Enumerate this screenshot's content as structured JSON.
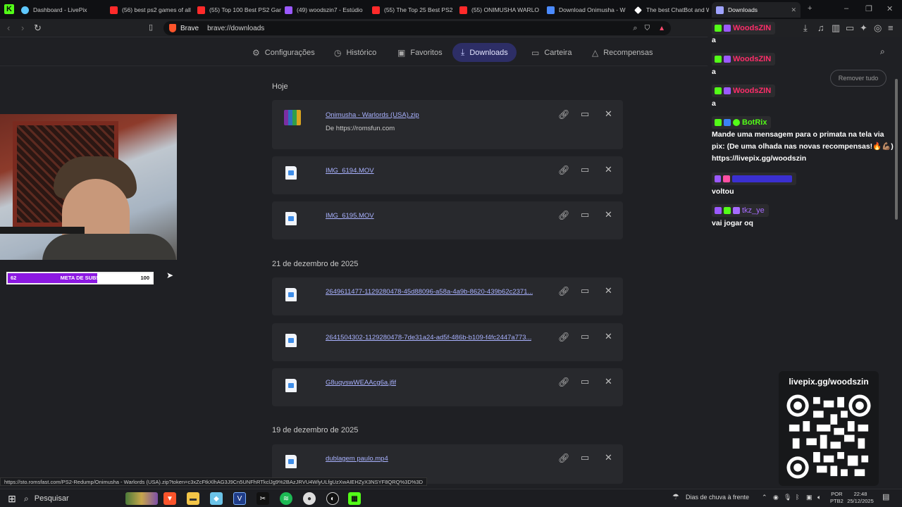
{
  "tabs": [
    {
      "title": "Dashboard - LivePix",
      "color": "#5ec8ff"
    },
    {
      "title": "(56) best ps2 games of all",
      "color": "#ff2a2a"
    },
    {
      "title": "(55) Top 100 Best PS2 Gar",
      "color": "#ff2a2a"
    },
    {
      "title": "(49) woodszin7 - Estúdio",
      "color": "#9b59ff"
    },
    {
      "title": "(55) The Top 25 Best PS2",
      "color": "#ff2a2a"
    },
    {
      "title": "(55) ONIMUSHA WARLO",
      "color": "#ff2a2a"
    },
    {
      "title": "Download Onimusha - W",
      "color": "#4b8bff"
    },
    {
      "title": "The best ChatBot and W",
      "color": "#ffffff"
    },
    {
      "title": "Downloads",
      "color": "#9fa3ff"
    }
  ],
  "toolbar": {
    "browser_name": "Brave",
    "url": "brave://downloads"
  },
  "nav": {
    "settings": "Configurações",
    "history": "Histórico",
    "bookmarks": "Favoritos",
    "downloads": "Downloads",
    "wallet": "Carteira",
    "rewards": "Recompensas"
  },
  "sections": [
    {
      "title": "Hoje",
      "items": [
        {
          "name": "Onimusha - Warlords (USA).zip",
          "source": "De https://romsfun.com",
          "type": "archive"
        },
        {
          "name": "IMG_6194.MOV",
          "source": "",
          "type": "video"
        },
        {
          "name": "IMG_6195.MOV",
          "source": "",
          "type": "video"
        }
      ]
    },
    {
      "title": "21 de dezembro de 2025",
      "items": [
        {
          "name": "2649611477-1129280478-45d88096-a58a-4a9b-8620-439b62c2371...",
          "source": "",
          "type": "video"
        },
        {
          "name": "2641504302-1129280478-7de31a24-ad5f-486b-b109-f4fc2447a773...",
          "source": "",
          "type": "video"
        },
        {
          "name": "G8uqvswWEAAcg6a.jfif",
          "source": "",
          "type": "image"
        }
      ]
    },
    {
      "title": "19 de dezembro de 2025",
      "items": [
        {
          "name": "dublagem paulo.mp4",
          "source": "",
          "type": "video"
        }
      ]
    }
  ],
  "status_url": "https://sto.romsfast.com/PS2-Redump/Onimusha - Warlords (USA).zip?token=c3xZcFtkXlhAG3J9Cn5UNFhRTkclJg9%2BAzJRVU4WlyULfgUzXwAIEHZyX3NSYF8QRQ%3D%3D",
  "goal": {
    "current": "62",
    "label": "META DE SUBS",
    "max": "100",
    "progress": 0.62
  },
  "chat": {
    "remove_all": "Remover tudo",
    "messages": [
      {
        "user": "WoodsZIN",
        "color": "#ff2d6a",
        "text": "a"
      },
      {
        "user": "WoodsZIN",
        "color": "#ff2d6a",
        "text": "a"
      },
      {
        "user": "WoodsZIN",
        "color": "#ff2d6a",
        "text": "a"
      },
      {
        "user": "BotRix",
        "color": "#53fc18",
        "text": "Mande uma mensagem para o primata na tela via pix: (De uma olhada nas novas recompensas!🔥💪🏽) https://livepix.gg/woodszin"
      },
      {
        "user": "",
        "color": "#5b3bff",
        "text": "voltou"
      },
      {
        "user": "tkz_ye",
        "color": "#a66bff",
        "text": "vai jogar oq"
      }
    ]
  },
  "qr": {
    "title": "livepix.gg/woodszin"
  },
  "taskbar": {
    "search_placeholder": "Pesquisar",
    "weather": "Dias de chuva à frente",
    "lang_top": "POR",
    "lang_bottom": "PTB2",
    "time": "22:48",
    "date": "25/12/2025"
  },
  "colors": {
    "accent": "#2d2e66",
    "link": "#a9b2ff",
    "brave": "#fb542b",
    "kick": "#53fc18",
    "goal_fill": "#8c18e2"
  }
}
